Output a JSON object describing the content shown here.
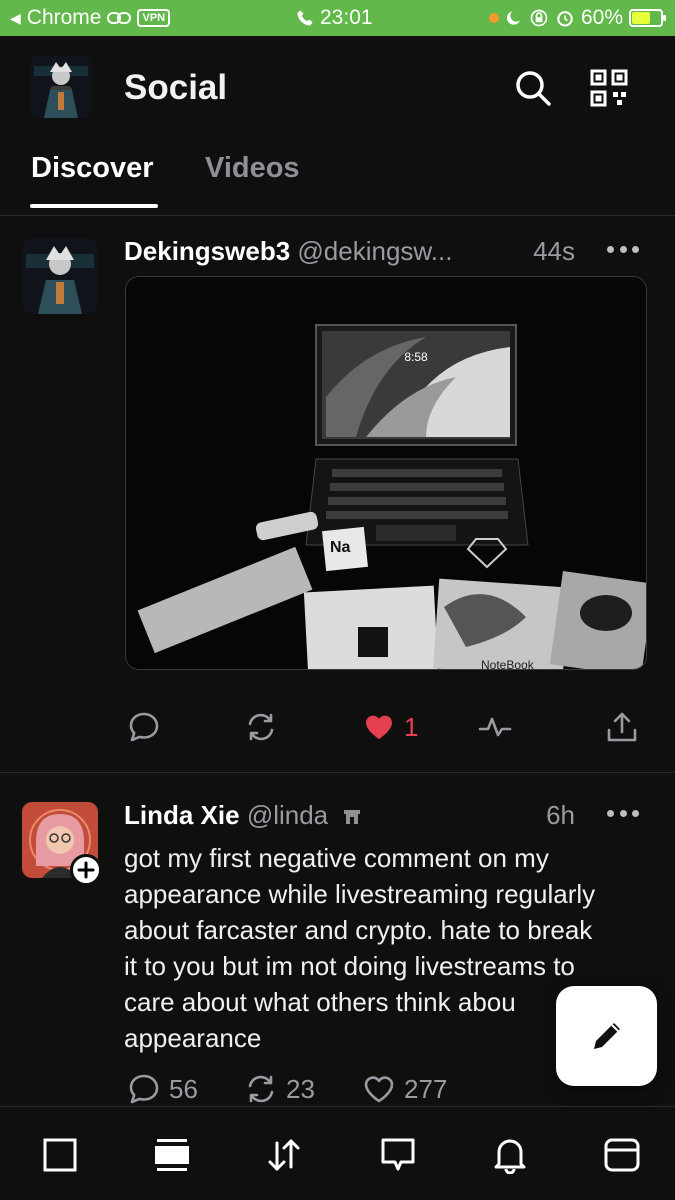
{
  "status_bar": {
    "back_app": "Chrome",
    "vpn": "VPN",
    "time": "23:01",
    "battery": "60%"
  },
  "header": {
    "title": "Social",
    "tabs": [
      {
        "label": "Discover",
        "active": true
      },
      {
        "label": "Videos",
        "active": false
      }
    ]
  },
  "posts": [
    {
      "author": "Dekingsweb3",
      "handle": "@dekingsw...",
      "time": "44s",
      "image_description_icon": "laptop-photo",
      "actions": {
        "reply_count": "",
        "recast_count": "",
        "like_count": "1",
        "liked": true
      }
    },
    {
      "author": "Linda Xie",
      "handle": "@linda",
      "time": "6h",
      "text_lines": [
        "got my first negative comment on my",
        "appearance while livestreaming regularly",
        "about farcaster and crypto. hate to break",
        "it to you but im not doing livestreams to",
        "care about what others think abou",
        "appearance"
      ],
      "actions": {
        "reply_count": "56",
        "recast_count": "23",
        "like_count": "277"
      }
    }
  ],
  "colors": {
    "status_bar": "#62b84a",
    "background": "#0f0f10",
    "like": "#e4404f",
    "muted": "#9a9aa0"
  }
}
